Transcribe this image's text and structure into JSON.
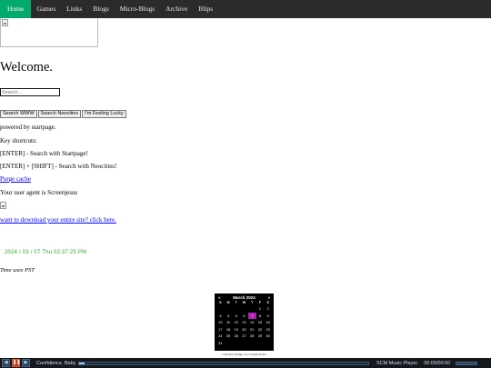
{
  "nav": {
    "items": [
      {
        "label": "Home",
        "active": true
      },
      {
        "label": "Games"
      },
      {
        "label": "Links"
      },
      {
        "label": "Blogs"
      },
      {
        "label": "Micro-Blogs"
      },
      {
        "label": "Archive"
      },
      {
        "label": "Blips"
      }
    ],
    "colors": {
      "background": "#2b2b2b",
      "active": "#04aa6d"
    }
  },
  "main": {
    "heading": "Welcome.",
    "search_placeholder": "Search...",
    "buttons": {
      "search_www": "Search WWW",
      "search_neocities": "Search Neocities",
      "lucky": "I'm Feeling Lucky"
    },
    "powered_by": "powered by startpage.",
    "shortcuts_title": "Key shortcuts:",
    "shortcut_1": "[ENTER] - Search with Startpage!",
    "shortcut_2": "[ENTER] + [SHIFT] - Search with Neocities!",
    "purge_link": "Purge cache",
    "user_agent": "Your user agent is Screenjesus",
    "download_link": "want to download your entire site? click here.",
    "clock": "2024 / 03 / 07 Thu 02:37:25 PM",
    "clock_color": "#2ea42e",
    "timezone_note": "Time uses PST"
  },
  "calendar": {
    "prev": "«",
    "next": "»",
    "title": "March 2024",
    "weekdays": [
      "S",
      "M",
      "T",
      "W",
      "T",
      "F",
      "S"
    ],
    "days": [
      "",
      "",
      "",
      "",
      "",
      "1",
      "2",
      "3",
      "4",
      "5",
      "6",
      "7",
      "8",
      "9",
      "10",
      "11",
      "12",
      "13",
      "14",
      "15",
      "16",
      "17",
      "18",
      "19",
      "20",
      "21",
      "22",
      "23",
      "24",
      "25",
      "26",
      "27",
      "28",
      "29",
      "30",
      "31",
      "",
      "",
      "",
      "",
      "",
      ""
    ],
    "today": "7",
    "highlight_color": "#b020b0",
    "caption": "Calendar Widget by CalendarLabs"
  },
  "player": {
    "track": "Confidence, Baby",
    "name": "SCM Music Player",
    "time": "00:00/00:00",
    "progress": 0.02,
    "buttons": {
      "prev_icon": "previous-icon",
      "play_icon": "play-pause-icon",
      "next_icon": "next-icon"
    }
  }
}
